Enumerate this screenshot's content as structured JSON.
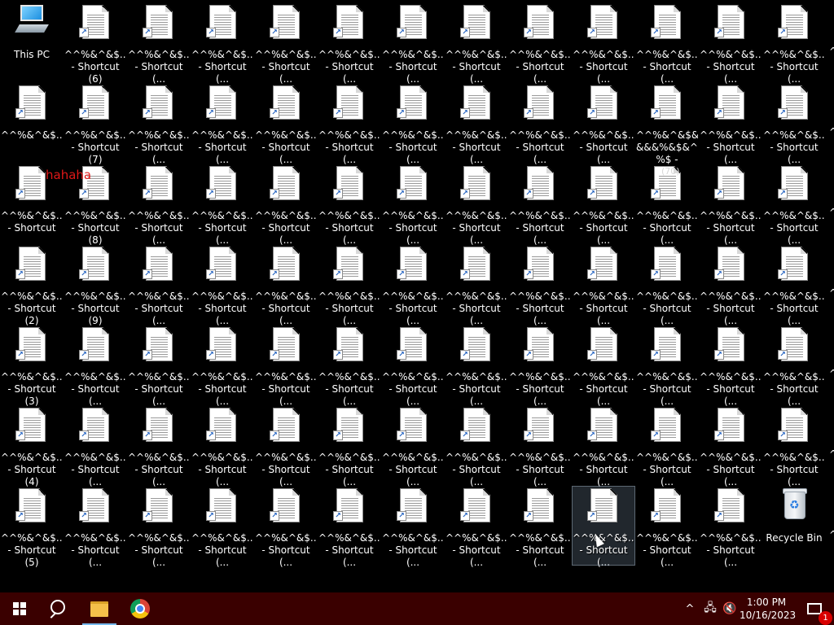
{
  "desktop": {
    "system_icons": [
      {
        "name": "this-pc",
        "label": "This PC"
      },
      {
        "name": "recycle-bin",
        "label": "Recycle Bin"
      }
    ],
    "grid": [
      [
        "",
        "^^%&^&$...\n- Shortcut (6)",
        "^^%&^&$...\n- Shortcut (...",
        "^^%&^&$...\n- Shortcut (...",
        "^^%&^&$...\n- Shortcut (...",
        "^^%&^&$...\n- Shortcut (...",
        "^^%&^&$...\n- Shortcut (...",
        "^^%&^&$...\n- Shortcut (...",
        "^^%&^&$...\n- Shortcut (...",
        "^^%&^&$...\n- Shortcut (...",
        "^^%&^&$...\n- Shortcut (...",
        "^^%&^&$...\n- Shortcut (...",
        "^^%&^&$...\n- Shortcut (..."
      ],
      [
        "^^%&^&$...",
        "^^%&^&$...\n- Shortcut (7)",
        "^^%&^&$...\n- Shortcut (...",
        "^^%&^&$...\n- Shortcut (...",
        "^^%&^&$...\n- Shortcut (...",
        "^^%&^&$...\n- Shortcut (...",
        "^^%&^&$...\n- Shortcut (...",
        "^^%&^&$...\n- Shortcut (...",
        "^^%&^&$...\n- Shortcut (...",
        "^^%&^&$...\n- Shortcut (...",
        "^^%&^&$&\n&&&%&$&^\n%$ - Shortcut",
        "^^%&^&$...\n- Shortcut (...",
        "^^%&^&$...\n- Shortcut (..."
      ],
      [
        "^^%&^&$...\n- Shortcut",
        "^^%&^&$...\n- Shortcut (8)",
        "^^%&^&$...\n- Shortcut (...",
        "^^%&^&$...\n- Shortcut (...",
        "^^%&^&$...\n- Shortcut (...",
        "^^%&^&$...\n- Shortcut (...",
        "^^%&^&$...\n- Shortcut (...",
        "^^%&^&$...\n- Shortcut (...",
        "^^%&^&$...\n- Shortcut (...",
        "^^%&^&$...\n- Shortcut (...",
        "^^%&^&$...\n- Shortcut (...",
        "^^%&^&$...\n- Shortcut (...",
        "^^%&^&$...\n- Shortcut (..."
      ],
      [
        "^^%&^&$...\n- Shortcut (2)",
        "^^%&^&$...\n- Shortcut (9)",
        "^^%&^&$...\n- Shortcut (...",
        "^^%&^&$...\n- Shortcut (...",
        "^^%&^&$...\n- Shortcut (...",
        "^^%&^&$...\n- Shortcut (...",
        "^^%&^&$...\n- Shortcut (...",
        "^^%&^&$...\n- Shortcut (...",
        "^^%&^&$...\n- Shortcut (...",
        "^^%&^&$...\n- Shortcut (...",
        "^^%&^&$...\n- Shortcut (...",
        "^^%&^&$...\n- Shortcut (...",
        "^^%&^&$...\n- Shortcut (..."
      ],
      [
        "^^%&^&$...\n- Shortcut (3)",
        "^^%&^&$...\n- Shortcut (...",
        "^^%&^&$...\n- Shortcut (...",
        "^^%&^&$...\n- Shortcut (...",
        "^^%&^&$...\n- Shortcut (...",
        "^^%&^&$...\n- Shortcut (...",
        "^^%&^&$...\n- Shortcut (...",
        "^^%&^&$...\n- Shortcut (...",
        "^^%&^&$...\n- Shortcut (...",
        "^^%&^&$...\n- Shortcut (...",
        "^^%&^&$...\n- Shortcut (...",
        "^^%&^&$...\n- Shortcut (...",
        "^^%&^&$...\n- Shortcut (..."
      ],
      [
        "^^%&^&$...\n- Shortcut (4)",
        "^^%&^&$...\n- Shortcut (...",
        "^^%&^&$...\n- Shortcut (...",
        "^^%&^&$...\n- Shortcut (...",
        "^^%&^&$...\n- Shortcut (...",
        "^^%&^&$...\n- Shortcut (...",
        "^^%&^&$...\n- Shortcut (...",
        "^^%&^&$...\n- Shortcut (...",
        "^^%&^&$...\n- Shortcut (...",
        "^^%&^&$...\n- Shortcut (...",
        "^^%&^&$...\n- Shortcut (...",
        "^^%&^&$...\n- Shortcut (...",
        "^^%&^&$...\n- Shortcut (..."
      ],
      [
        "^^%&^&$...\n- Shortcut (5)",
        "^^%&^&$...\n- Shortcut (...",
        "^^%&^&$...\n- Shortcut (...",
        "^^%&^&$...\n- Shortcut (...",
        "^^%&^&$...\n- Shortcut (...",
        "^^%&^&$...\n- Shortcut (...",
        "^^%&^&$...\n- Shortcut (...",
        "^^%&^&$...\n- Shortcut (...",
        "^^%&^&$...\n- Shortcut (...",
        "^^%&^&$...\n- Shortcut (...",
        "^^%&^&$...\n- Shortcut (...",
        "^^%&^&$...\n- Shortcut (...",
        ""
      ]
    ],
    "edge_mark": "^",
    "overlay_text": "hahaha",
    "badge_text": "(70)"
  },
  "taskbar": {
    "background": "#3a0000",
    "pinned": [
      {
        "name": "start-button",
        "icon": "windows-logo-icon"
      },
      {
        "name": "search-button",
        "icon": "search-icon"
      },
      {
        "name": "file-explorer-button",
        "icon": "folder-icon"
      },
      {
        "name": "chrome-button",
        "icon": "chrome-icon"
      }
    ],
    "tray": {
      "chevron": "^",
      "network_icon": "network-icon",
      "volume_icon": "volume-muted-icon",
      "time": "1:00 PM",
      "date": "10/16/2023",
      "notification_count": "1"
    }
  }
}
